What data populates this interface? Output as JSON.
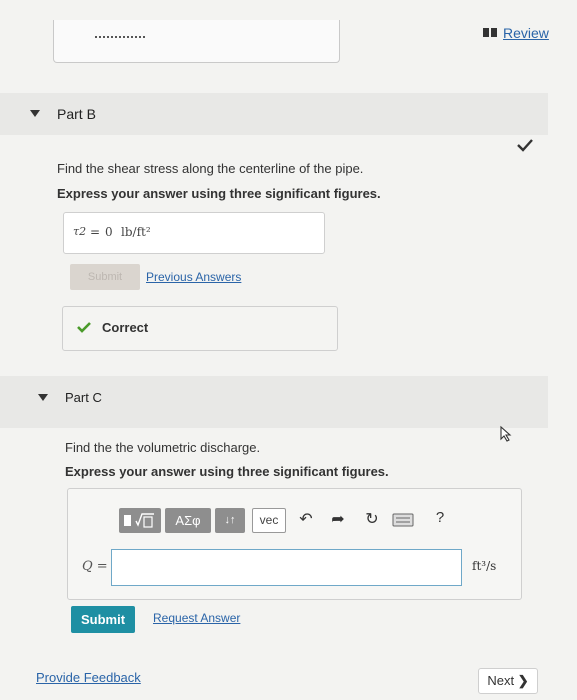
{
  "header": {
    "review_label": "Review"
  },
  "part_b": {
    "title": "Part B",
    "question": "Find the shear stress along the centerline of the pipe.",
    "instruction": "Express your answer using three significant figures.",
    "answer_variable": "τ2",
    "answer_equals": "=",
    "answer_value": "0",
    "answer_unit": "lb/ft²",
    "submit_label": "Submit",
    "previous_answers_label": "Previous Answers",
    "correct_label": "Correct"
  },
  "part_c": {
    "title": "Part C",
    "question": "Find the the volumetric discharge.",
    "instruction": "Express your answer using three significant figures.",
    "toolbar": {
      "greek_label": "ΑΣφ",
      "arrows_label": "↓↑",
      "vec_label": "vec",
      "help_label": "?"
    },
    "input_label": "Q =",
    "input_value": "",
    "unit": "ft³/s",
    "submit_label": "Submit",
    "request_answer_label": "Request Answer"
  },
  "footer": {
    "feedback_label": "Provide Feedback",
    "next_label": "Next"
  },
  "colors": {
    "accent": "#1e8fa3",
    "correct_green": "#4a9a2a",
    "link": "#2a64a8"
  }
}
